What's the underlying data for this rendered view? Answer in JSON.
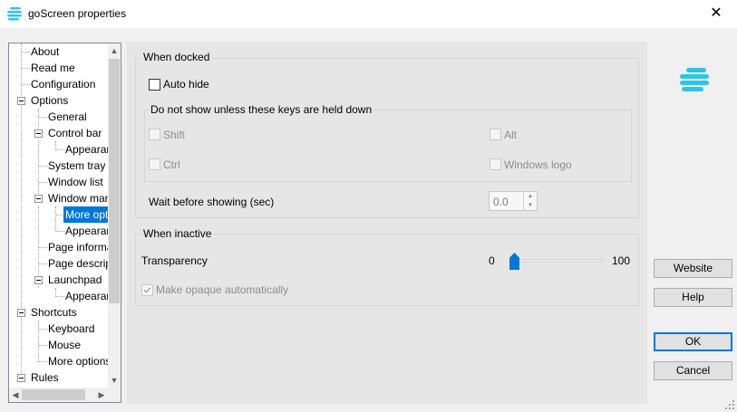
{
  "window": {
    "title": "goScreen properties",
    "close_glyph": "✕"
  },
  "tree": {
    "items": [
      {
        "label": "About"
      },
      {
        "label": "Read me"
      },
      {
        "label": "Configuration"
      },
      {
        "label": "Options"
      },
      {
        "label": "General"
      },
      {
        "label": "Control bar"
      },
      {
        "label": "Appearance"
      },
      {
        "label": "System tray"
      },
      {
        "label": "Window list"
      },
      {
        "label": "Window management"
      },
      {
        "label": "More options"
      },
      {
        "label": "Appearance"
      },
      {
        "label": "Page information"
      },
      {
        "label": "Page description"
      },
      {
        "label": "Launchpad"
      },
      {
        "label": "Appearance"
      },
      {
        "label": "Shortcuts"
      },
      {
        "label": "Keyboard"
      },
      {
        "label": "Mouse"
      },
      {
        "label": "More options"
      },
      {
        "label": "Rules"
      }
    ],
    "selected": "More options"
  },
  "docked": {
    "title": "When docked",
    "auto_hide": "Auto hide",
    "keys_title": "Do not show unless these keys are held down",
    "shift": "Shift",
    "ctrl": "Ctrl",
    "alt": "Alt",
    "windows_logo": "Windows logo",
    "wait_label": "Wait before showing (sec)",
    "wait_value": "0.0"
  },
  "inactive": {
    "title": "When inactive",
    "transparency": "Transparency",
    "min": "0",
    "max": "100",
    "value_fraction": 0.0,
    "opaque": "Make opaque automatically"
  },
  "buttons": {
    "website": "Website",
    "help": "Help",
    "ok": "OK",
    "cancel": "Cancel"
  },
  "colors": {
    "accent": "#0078d7",
    "logo": "#2ec4e6"
  }
}
